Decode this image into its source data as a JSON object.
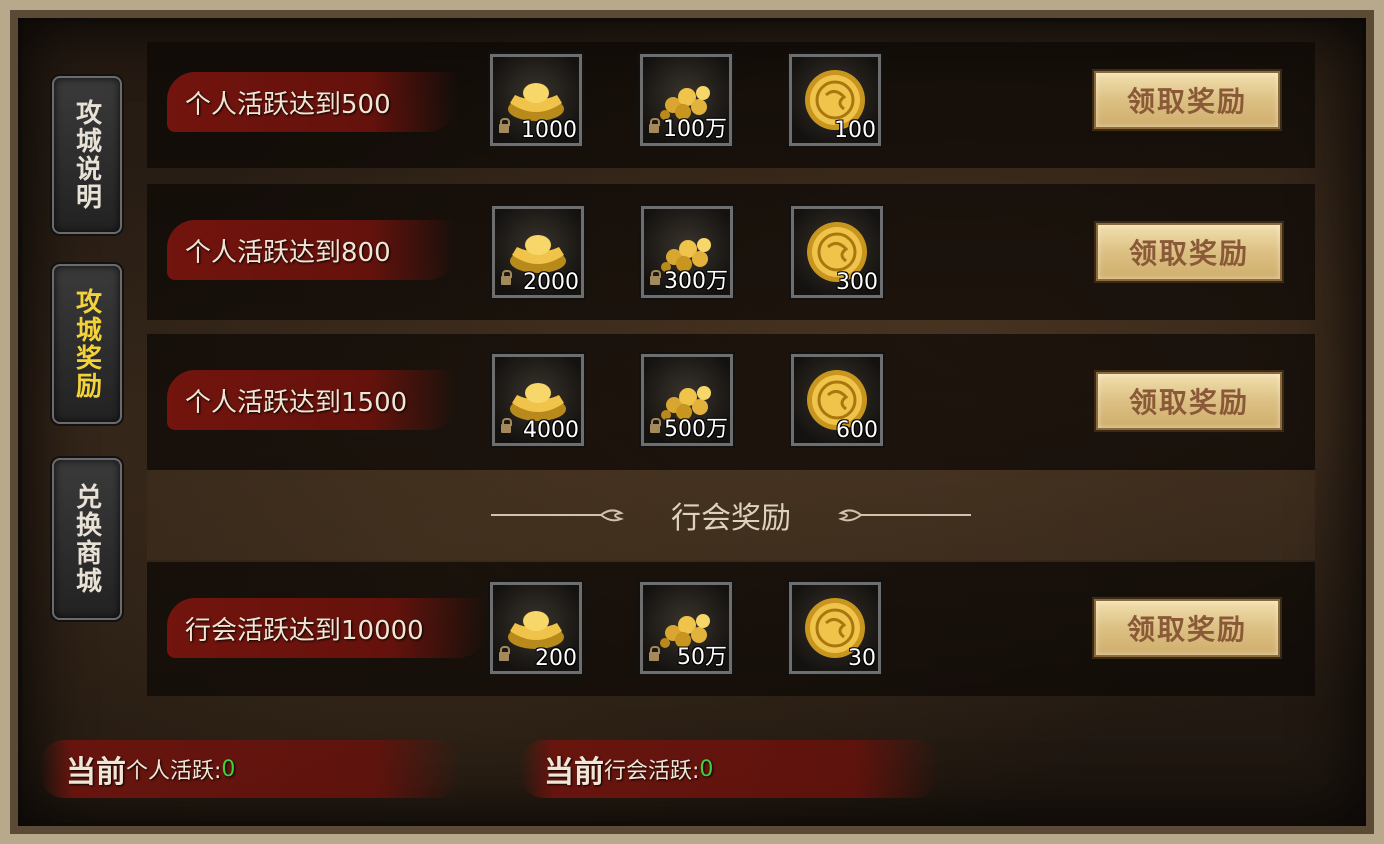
{
  "side_tabs": [
    {
      "label": "攻城说明",
      "active": false
    },
    {
      "label": "攻城奖励",
      "active": true
    },
    {
      "label": "兑换商城",
      "active": false
    }
  ],
  "personal_rows": [
    {
      "title": "个人活跃达到500",
      "rewards": [
        {
          "icon": "gold-ingot-icon",
          "qty": "1000",
          "locked": true
        },
        {
          "icon": "gold-coins-icon",
          "qty": "100万",
          "locked": true
        },
        {
          "icon": "gold-medal-icon",
          "qty": "100",
          "locked": false
        }
      ],
      "button": "领取奖励"
    },
    {
      "title": "个人活跃达到800",
      "rewards": [
        {
          "icon": "gold-ingot-icon",
          "qty": "2000",
          "locked": true
        },
        {
          "icon": "gold-coins-icon",
          "qty": "300万",
          "locked": true
        },
        {
          "icon": "gold-medal-icon",
          "qty": "300",
          "locked": false
        }
      ],
      "button": "领取奖励"
    },
    {
      "title": "个人活跃达到1500",
      "rewards": [
        {
          "icon": "gold-ingot-icon",
          "qty": "4000",
          "locked": true
        },
        {
          "icon": "gold-coins-icon",
          "qty": "500万",
          "locked": true
        },
        {
          "icon": "gold-medal-icon",
          "qty": "600",
          "locked": false
        }
      ],
      "button": "领取奖励"
    }
  ],
  "guild_section_title": "行会奖励",
  "guild_rows": [
    {
      "title": "行会活跃达到10000",
      "rewards": [
        {
          "icon": "gold-ingot-icon",
          "qty": "200",
          "locked": true
        },
        {
          "icon": "gold-coins-icon",
          "qty": "50万",
          "locked": true
        },
        {
          "icon": "gold-medal-icon",
          "qty": "30",
          "locked": false
        }
      ],
      "button": "领取奖励"
    }
  ],
  "footer": {
    "personal": {
      "prefix": "当前",
      "label": "个人活跃:",
      "value": "0"
    },
    "guild": {
      "prefix": "当前",
      "label": "行会活跃:",
      "value": "0"
    }
  },
  "colors": {
    "active_tab_text": "#f3d23a",
    "tab_text": "#e8e2d6",
    "activity_value": "#3fcf3f",
    "button_text": "#8a5a38"
  }
}
